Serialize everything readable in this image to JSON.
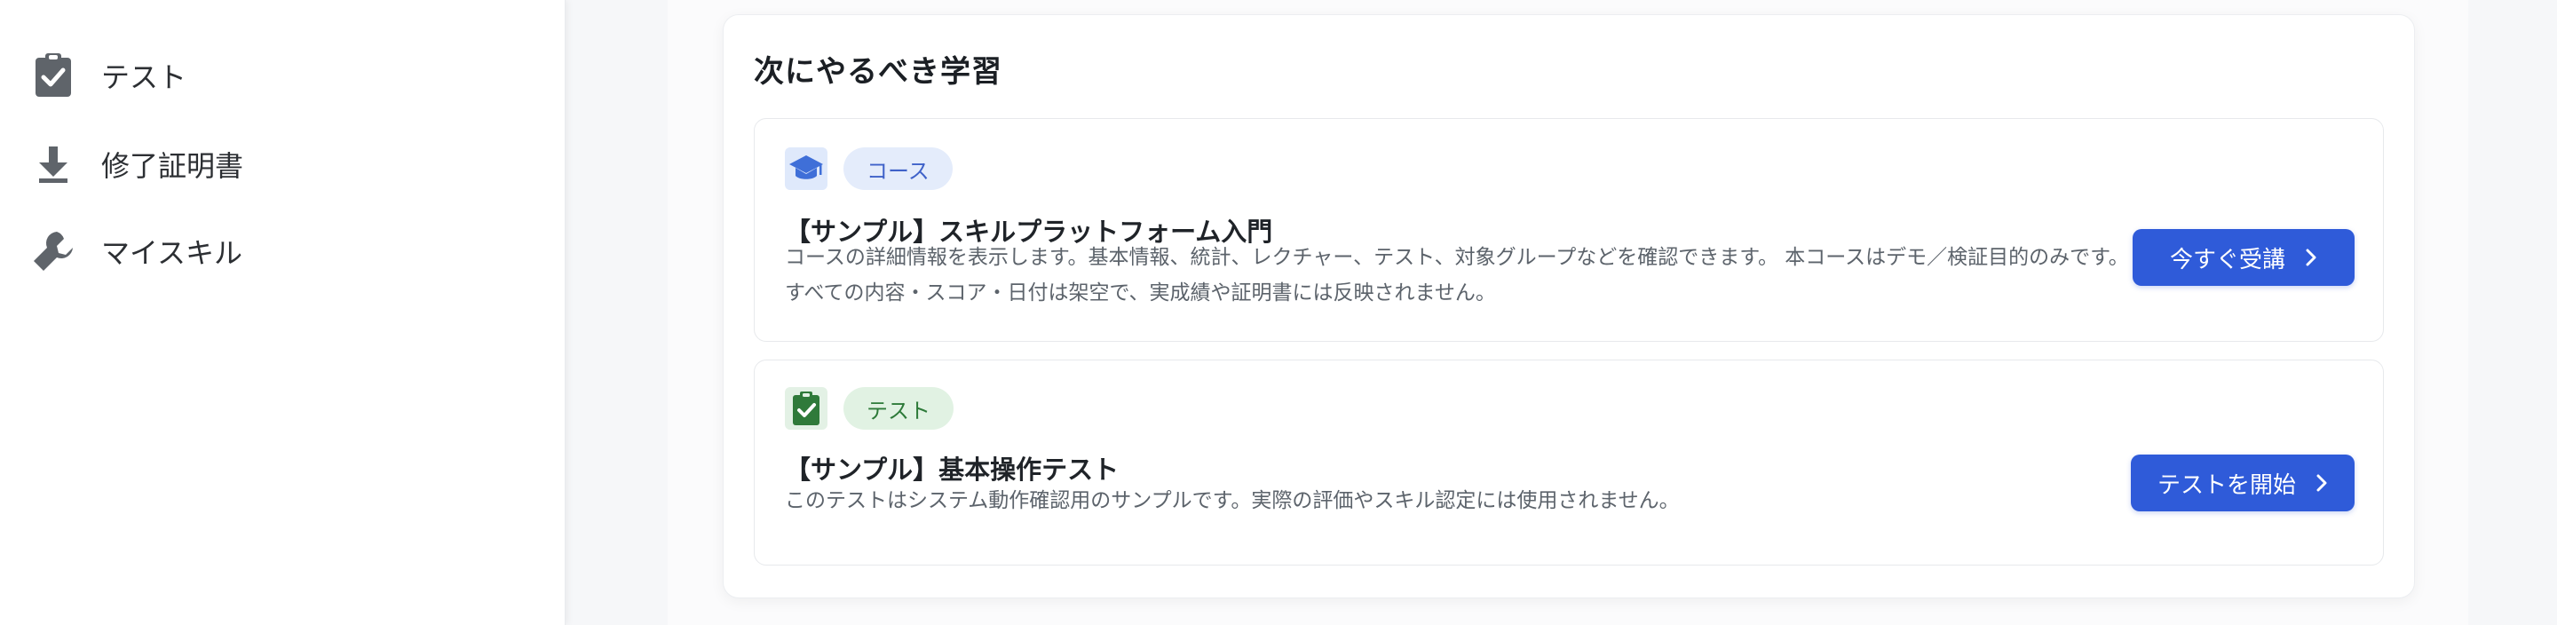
{
  "sidebar": {
    "items": [
      {
        "icon": "clipboard-check-icon",
        "label": "テスト"
      },
      {
        "icon": "download-icon",
        "label": "修了証明書"
      },
      {
        "icon": "wrench-icon",
        "label": "マイスキル"
      }
    ]
  },
  "next_learning": {
    "title": "次にやるべき学習",
    "cards": [
      {
        "icon": "graduation-cap-icon",
        "tag": "コース",
        "title": "【サンプル】スキルプラットフォーム入門",
        "description": "コースの詳細情報を表示します。基本情報、統計、レクチャー、テスト、対象グループなどを確認できます。 本コースはデモ／検証目的のみです。すべての内容・スコア・日付は架空で、実成績や証明書には反映されません。",
        "button": "今すぐ受講"
      },
      {
        "icon": "clipboard-check-icon",
        "tag": "テスト",
        "title": "【サンプル】基本操作テスト",
        "description": "このテストはシステム動作確認用のサンプルです。実際の評価やスキル認定には使用されません。",
        "button": "テストを開始"
      }
    ]
  },
  "colors": {
    "primary": "#2f5bd9",
    "course_accent": "#3f62c9",
    "test_accent": "#2d7a39"
  }
}
